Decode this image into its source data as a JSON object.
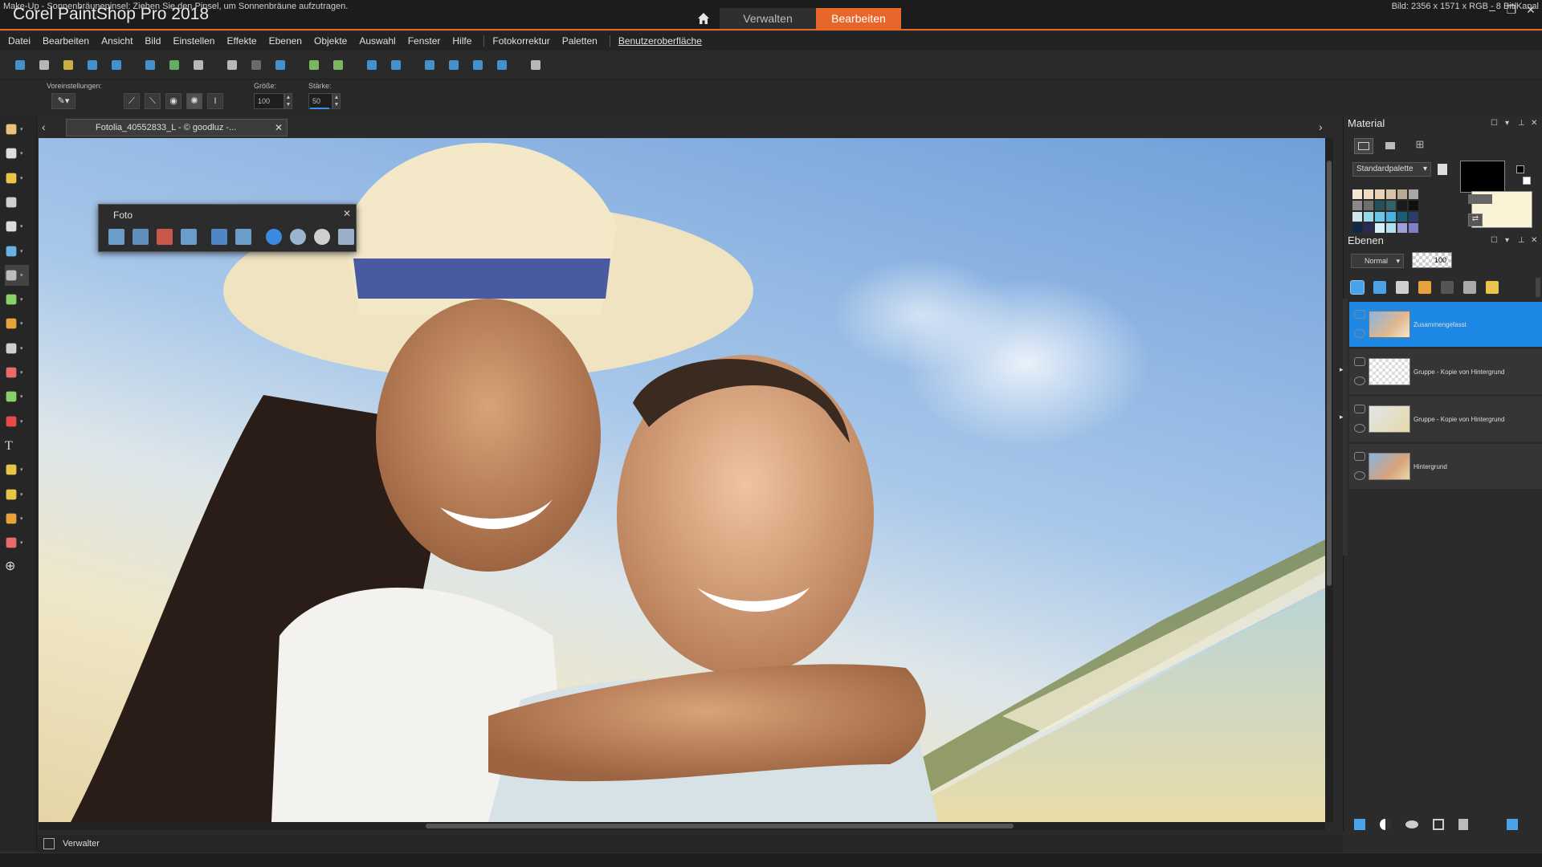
{
  "app": {
    "title": "Corel PaintShop Pro 2018"
  },
  "workspace_tabs": {
    "manage": "Verwalten",
    "edit": "Bearbeiten"
  },
  "window_controls": {
    "minimize": "–",
    "restore": "❐",
    "close": "✕"
  },
  "menu": [
    "Datei",
    "Bearbeiten",
    "Ansicht",
    "Bild",
    "Einstellen",
    "Effekte",
    "Ebenen",
    "Objekte",
    "Auswahl",
    "Fenster",
    "Hilfe",
    "Fotokorrektur",
    "Paletten",
    "Benutzeroberfläche"
  ],
  "toolbar": {
    "icons": [
      "new-file-icon",
      "grid-icon",
      "open-folder-icon",
      "scan-icon",
      "save-icon",
      "save-as-icon",
      "share-icon",
      "print-icon",
      "undo-icon",
      "redo-icon",
      "resize-icon",
      "rotate-left-icon",
      "rotate-right-icon",
      "info-icon",
      "fit-window-icon",
      "actual-size-icon",
      "zoom-out-icon",
      "zoom-in-icon",
      "zoom-fit-icon",
      "paste-icon"
    ],
    "colors": [
      "#4aa3e8",
      "#cfcfcf",
      "#e8c54a",
      "#4aa3e8",
      "#4aa3e8",
      "#4aa3e8",
      "#6ec36e",
      "#d0d0d0",
      "#d0d0d0",
      "#777777",
      "#4aa3e8",
      "#8ad06a",
      "#8ad06a",
      "#4aa3e8",
      "#4aa3e8",
      "#4aa3e8",
      "#4aa3e8",
      "#4aa3e8",
      "#4aa3e8",
      "#d0d0d0"
    ]
  },
  "options": {
    "presets_label": "Voreinstellungen:",
    "size_label": "Größe:",
    "size_value": "100",
    "strength_label": "Stärke:",
    "strength_value": "50"
  },
  "tools": [
    "pan-icon",
    "pick-icon",
    "lasso-icon",
    "dropper-icon",
    "crop-icon",
    "straighten-icon",
    "makeup-icon",
    "clone-icon",
    "paint-brush-icon",
    "fill-icon",
    "eraser-icon",
    "retouch-icon",
    "red-eye-icon",
    "text-icon",
    "preset-shape-icon",
    "pen-icon",
    "warp-brush-icon",
    "color-replacer-icon",
    "add-tool-icon"
  ],
  "document": {
    "tab_title": "Fotolia_40552833_L - © goodluz -..."
  },
  "foto_palette": {
    "title": "Foto",
    "tools": [
      "smart-photo-fix-icon",
      "one-step-fix-icon",
      "red-eye-fix-icon",
      "fill-light-icon",
      "local-tone-icon",
      "perspective-icon",
      "retro-lab-icon",
      "time-machine-icon",
      "depth-icon",
      "selective-focus-icon"
    ],
    "colors": [
      "#6a9ccc",
      "#5e8fbf",
      "#c8584a",
      "#6a9ccc",
      "#4f86c6",
      "#6a9ccc",
      "#3d8be0",
      "#9bb4d0",
      "#cfcfcf",
      "#9ab0c8"
    ]
  },
  "material_panel": {
    "title": "Material",
    "palette_select": "Standardpalette",
    "foreground_color": "#000000",
    "background_color": "#fbf3d6",
    "swatches": [
      "#f5e6cf",
      "#f1d9c2",
      "#e9d3b6",
      "#d8c3a8",
      "#b8a994",
      "#a6a6a6",
      "#8a8a8a",
      "#6d6d6d",
      "#24505a",
      "#33606a",
      "#1b1b1b",
      "#101010",
      "#cfe6ee",
      "#9ad7e8",
      "#6cc4e4",
      "#48b2dc",
      "#1c5d7a",
      "#26406a",
      "#10284a",
      "#2a2a5a",
      "#d7f0f8",
      "#b0e0ee",
      "#a0a0d8",
      "#8080c8"
    ]
  },
  "layers_panel": {
    "title": "Ebenen",
    "blend_mode": "Normal",
    "opacity": "100",
    "toolbar_icons": [
      "new-raster-layer-icon",
      "new-vector-layer-icon",
      "new-adjustment-layer-icon",
      "new-mask-icon",
      "layer-group-icon",
      "link-icon",
      "lock-icon"
    ],
    "layers": [
      {
        "name": "Zusammengefasst",
        "selected": true
      },
      {
        "name": "Gruppe - Kopie von Hintergrund",
        "selected": false
      },
      {
        "name": "Gruppe - Kopie von Hintergrund",
        "selected": false
      },
      {
        "name": "Hintergrund",
        "selected": false
      }
    ]
  },
  "manager_tab": {
    "label": "Verwalter"
  },
  "status": {
    "left": "Make-Up - Sonnenbräunepinsel: Ziehen Sie den Pinsel, um Sonnenbräune aufzutragen.",
    "right": "Bild: 2356 x 1571 x RGB - 8 Bit/Kanal"
  }
}
